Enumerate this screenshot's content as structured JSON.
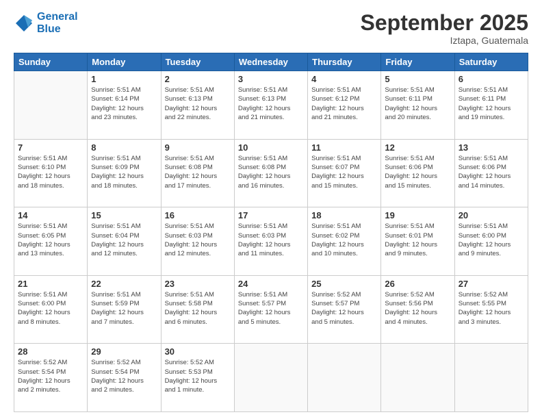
{
  "logo": {
    "line1": "General",
    "line2": "Blue"
  },
  "title": "September 2025",
  "subtitle": "Iztapa, Guatemala",
  "weekdays": [
    "Sunday",
    "Monday",
    "Tuesday",
    "Wednesday",
    "Thursday",
    "Friday",
    "Saturday"
  ],
  "weeks": [
    [
      {
        "day": "",
        "info": ""
      },
      {
        "day": "1",
        "info": "Sunrise: 5:51 AM\nSunset: 6:14 PM\nDaylight: 12 hours\nand 23 minutes."
      },
      {
        "day": "2",
        "info": "Sunrise: 5:51 AM\nSunset: 6:13 PM\nDaylight: 12 hours\nand 22 minutes."
      },
      {
        "day": "3",
        "info": "Sunrise: 5:51 AM\nSunset: 6:13 PM\nDaylight: 12 hours\nand 21 minutes."
      },
      {
        "day": "4",
        "info": "Sunrise: 5:51 AM\nSunset: 6:12 PM\nDaylight: 12 hours\nand 21 minutes."
      },
      {
        "day": "5",
        "info": "Sunrise: 5:51 AM\nSunset: 6:11 PM\nDaylight: 12 hours\nand 20 minutes."
      },
      {
        "day": "6",
        "info": "Sunrise: 5:51 AM\nSunset: 6:11 PM\nDaylight: 12 hours\nand 19 minutes."
      }
    ],
    [
      {
        "day": "7",
        "info": "Sunrise: 5:51 AM\nSunset: 6:10 PM\nDaylight: 12 hours\nand 18 minutes."
      },
      {
        "day": "8",
        "info": "Sunrise: 5:51 AM\nSunset: 6:09 PM\nDaylight: 12 hours\nand 18 minutes."
      },
      {
        "day": "9",
        "info": "Sunrise: 5:51 AM\nSunset: 6:08 PM\nDaylight: 12 hours\nand 17 minutes."
      },
      {
        "day": "10",
        "info": "Sunrise: 5:51 AM\nSunset: 6:08 PM\nDaylight: 12 hours\nand 16 minutes."
      },
      {
        "day": "11",
        "info": "Sunrise: 5:51 AM\nSunset: 6:07 PM\nDaylight: 12 hours\nand 15 minutes."
      },
      {
        "day": "12",
        "info": "Sunrise: 5:51 AM\nSunset: 6:06 PM\nDaylight: 12 hours\nand 15 minutes."
      },
      {
        "day": "13",
        "info": "Sunrise: 5:51 AM\nSunset: 6:06 PM\nDaylight: 12 hours\nand 14 minutes."
      }
    ],
    [
      {
        "day": "14",
        "info": "Sunrise: 5:51 AM\nSunset: 6:05 PM\nDaylight: 12 hours\nand 13 minutes."
      },
      {
        "day": "15",
        "info": "Sunrise: 5:51 AM\nSunset: 6:04 PM\nDaylight: 12 hours\nand 12 minutes."
      },
      {
        "day": "16",
        "info": "Sunrise: 5:51 AM\nSunset: 6:03 PM\nDaylight: 12 hours\nand 12 minutes."
      },
      {
        "day": "17",
        "info": "Sunrise: 5:51 AM\nSunset: 6:03 PM\nDaylight: 12 hours\nand 11 minutes."
      },
      {
        "day": "18",
        "info": "Sunrise: 5:51 AM\nSunset: 6:02 PM\nDaylight: 12 hours\nand 10 minutes."
      },
      {
        "day": "19",
        "info": "Sunrise: 5:51 AM\nSunset: 6:01 PM\nDaylight: 12 hours\nand 9 minutes."
      },
      {
        "day": "20",
        "info": "Sunrise: 5:51 AM\nSunset: 6:00 PM\nDaylight: 12 hours\nand 9 minutes."
      }
    ],
    [
      {
        "day": "21",
        "info": "Sunrise: 5:51 AM\nSunset: 6:00 PM\nDaylight: 12 hours\nand 8 minutes."
      },
      {
        "day": "22",
        "info": "Sunrise: 5:51 AM\nSunset: 5:59 PM\nDaylight: 12 hours\nand 7 minutes."
      },
      {
        "day": "23",
        "info": "Sunrise: 5:51 AM\nSunset: 5:58 PM\nDaylight: 12 hours\nand 6 minutes."
      },
      {
        "day": "24",
        "info": "Sunrise: 5:51 AM\nSunset: 5:57 PM\nDaylight: 12 hours\nand 5 minutes."
      },
      {
        "day": "25",
        "info": "Sunrise: 5:52 AM\nSunset: 5:57 PM\nDaylight: 12 hours\nand 5 minutes."
      },
      {
        "day": "26",
        "info": "Sunrise: 5:52 AM\nSunset: 5:56 PM\nDaylight: 12 hours\nand 4 minutes."
      },
      {
        "day": "27",
        "info": "Sunrise: 5:52 AM\nSunset: 5:55 PM\nDaylight: 12 hours\nand 3 minutes."
      }
    ],
    [
      {
        "day": "28",
        "info": "Sunrise: 5:52 AM\nSunset: 5:54 PM\nDaylight: 12 hours\nand 2 minutes."
      },
      {
        "day": "29",
        "info": "Sunrise: 5:52 AM\nSunset: 5:54 PM\nDaylight: 12 hours\nand 2 minutes."
      },
      {
        "day": "30",
        "info": "Sunrise: 5:52 AM\nSunset: 5:53 PM\nDaylight: 12 hours\nand 1 minute."
      },
      {
        "day": "",
        "info": ""
      },
      {
        "day": "",
        "info": ""
      },
      {
        "day": "",
        "info": ""
      },
      {
        "day": "",
        "info": ""
      }
    ]
  ]
}
